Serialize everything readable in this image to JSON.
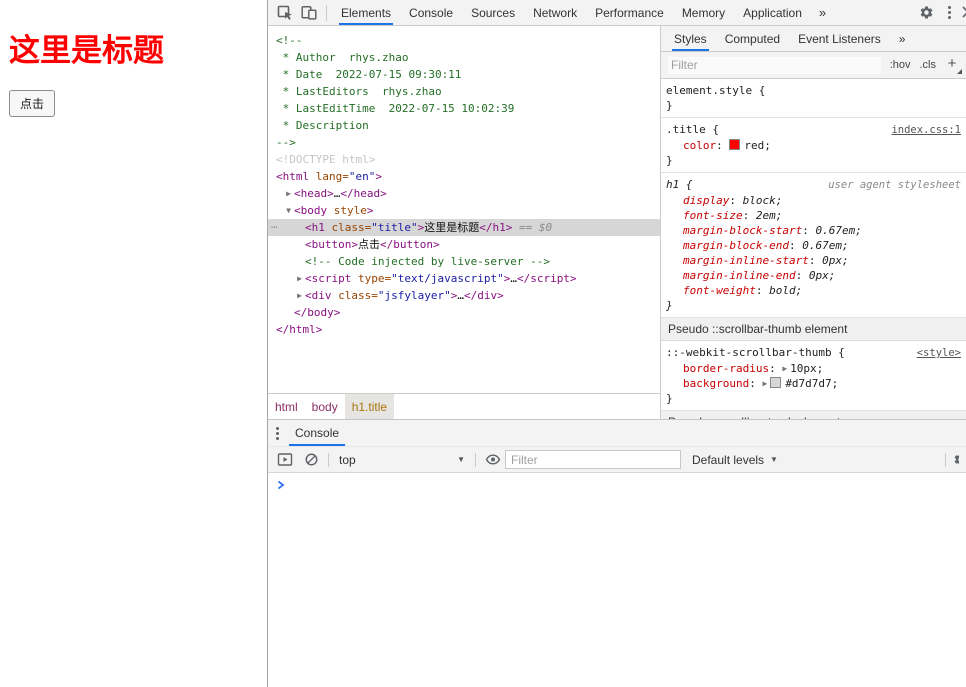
{
  "page": {
    "title": "这里是标题",
    "title_color": "#ff0000",
    "button_label": "点击"
  },
  "devtools": {
    "accent_color": "#1a73e8",
    "main_tabs": [
      "Elements",
      "Console",
      "Sources",
      "Network",
      "Performance",
      "Memory",
      "Application"
    ],
    "main_tabs_active": "Elements",
    "overflow_chevron": "»",
    "elements": {
      "dom_lines": [
        {
          "ind": 0,
          "segs": [
            [
              "cm",
              "<!--"
            ]
          ]
        },
        {
          "ind": 0,
          "segs": [
            [
              "cm",
              " * Author  rhys.zhao"
            ]
          ]
        },
        {
          "ind": 0,
          "segs": [
            [
              "cm",
              " * Date  2022-07-15 09:30:11"
            ]
          ]
        },
        {
          "ind": 0,
          "segs": [
            [
              "cm",
              " * LastEditors  rhys.zhao"
            ]
          ]
        },
        {
          "ind": 0,
          "segs": [
            [
              "cm",
              " * LastEditTime  2022-07-15 10:02:39"
            ]
          ]
        },
        {
          "ind": 0,
          "segs": [
            [
              "cm",
              " * Description  "
            ]
          ]
        },
        {
          "ind": 0,
          "segs": [
            [
              "cm",
              "-->"
            ]
          ]
        },
        {
          "ind": 0,
          "segs": [
            [
              "doc",
              "<!DOCTYPE html>"
            ]
          ]
        },
        {
          "ind": 0,
          "segs": [
            [
              "tag",
              "<html"
            ],
            [
              "attr",
              " lang="
            ],
            [
              "val",
              "\"en\""
            ],
            [
              "tag",
              ">"
            ]
          ]
        },
        {
          "ind": 1,
          "arrow": "▶",
          "segs": [
            [
              "tag",
              "<head>"
            ],
            [
              "txt",
              "…"
            ],
            [
              "tag",
              "</head>"
            ]
          ]
        },
        {
          "ind": 1,
          "arrow": "▼",
          "segs": [
            [
              "tag",
              "<body"
            ],
            [
              "attr",
              " style"
            ],
            [
              "tag",
              ">"
            ]
          ]
        },
        {
          "ind": 2,
          "sel": true,
          "segs": [
            [
              "tag",
              "<h1"
            ],
            [
              "attr",
              " class="
            ],
            [
              "val",
              "\"title\""
            ],
            [
              "tag",
              ">"
            ],
            [
              "txt",
              "这里是标题"
            ],
            [
              "tag",
              "</h1>"
            ],
            [
              "meta",
              " == $0"
            ]
          ]
        },
        {
          "ind": 2,
          "segs": [
            [
              "tag",
              "<button>"
            ],
            [
              "txt",
              "点击"
            ],
            [
              "tag",
              "</button>"
            ]
          ]
        },
        {
          "ind": 2,
          "segs": [
            [
              "cm",
              "<!-- Code injected by live-server -->"
            ]
          ]
        },
        {
          "ind": 2,
          "arrow": "▶",
          "segs": [
            [
              "tag",
              "<script"
            ],
            [
              "attr",
              " type="
            ],
            [
              "val",
              "\"text/javascript\""
            ],
            [
              "tag",
              ">"
            ],
            [
              "txt",
              "…"
            ],
            [
              "tag",
              "</script>"
            ]
          ]
        },
        {
          "ind": 2,
          "arrow": "▶",
          "segs": [
            [
              "tag",
              "<div"
            ],
            [
              "attr",
              " class="
            ],
            [
              "val",
              "\"jsfylayer\""
            ],
            [
              "tag",
              ">"
            ],
            [
              "txt",
              "…"
            ],
            [
              "tag",
              "</div>"
            ]
          ]
        },
        {
          "ind": 1,
          "segs": [
            [
              "tag",
              "</body>"
            ]
          ]
        },
        {
          "ind": 0,
          "segs": [
            [
              "tag",
              "</html>"
            ]
          ]
        }
      ],
      "breadcrumbs": [
        {
          "label": "html",
          "selected": false
        },
        {
          "label": "body",
          "selected": false
        },
        {
          "label": "h1.title",
          "selected": true
        }
      ]
    },
    "styles": {
      "tabs": [
        "Styles",
        "Computed",
        "Event Listeners"
      ],
      "active_tab": "Styles",
      "overflow_chevron": "»",
      "filter_placeholder": "Filter",
      "hov_label": ":hov",
      "cls_label": ".cls",
      "plus_label": "+",
      "sections": [
        {
          "type": "rule",
          "selector": "element.style",
          "props": []
        },
        {
          "type": "rule",
          "selector": ".title",
          "link": "index.css:1",
          "props": [
            {
              "name": "color",
              "value": "red;",
              "swatch": "#ff0000"
            }
          ]
        },
        {
          "type": "rule",
          "selector": "h1",
          "link": "user agent stylesheet",
          "ua": true,
          "props": [
            {
              "name": "display",
              "value": "block;"
            },
            {
              "name": "font-size",
              "value": "2em;"
            },
            {
              "name": "margin-block-start",
              "value": "0.67em;"
            },
            {
              "name": "margin-block-end",
              "value": "0.67em;"
            },
            {
              "name": "margin-inline-start",
              "value": "0px;"
            },
            {
              "name": "margin-inline-end",
              "value": "0px;"
            },
            {
              "name": "font-weight",
              "value": "bold;"
            }
          ]
        },
        {
          "type": "header",
          "text": "Pseudo ::scrollbar-thumb element"
        },
        {
          "type": "rule",
          "selector": "::-webkit-scrollbar-thumb",
          "link": "<style>",
          "props": [
            {
              "name": "border-radius",
              "value": "10px;",
              "expand": true
            },
            {
              "name": "background",
              "value": "#d7d7d7;",
              "expand": true,
              "swatch": "#d7d7d7"
            }
          ]
        },
        {
          "type": "header",
          "text": "Pseudo ::scrollbar-track element"
        }
      ]
    },
    "console": {
      "tab_label": "Console",
      "context_value": "top",
      "filter_placeholder": "Filter",
      "levels_label": "Default levels"
    }
  }
}
